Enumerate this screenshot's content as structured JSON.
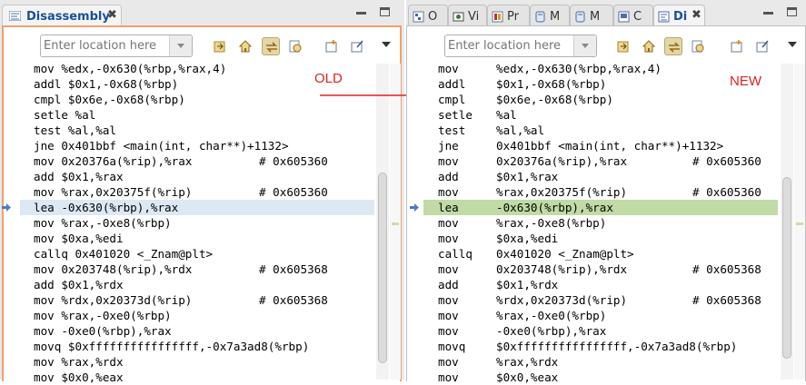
{
  "left_pane": {
    "tab_title": "Disassembly",
    "location_placeholder": "Enter location here",
    "annotation": "OLD",
    "lines": [
      {
        "mnem": "mov %edx,-0x630(%rbp,%rax,4)",
        "comment": ""
      },
      {
        "mnem": "addl $0x1,-0x68(%rbp)",
        "comment": ""
      },
      {
        "mnem": "cmpl $0x6e,-0x68(%rbp)",
        "comment": ""
      },
      {
        "mnem": "setle %al",
        "comment": ""
      },
      {
        "mnem": "test %al,%al",
        "comment": ""
      },
      {
        "mnem": "jne 0x401bbf <main(int, char**)+1132>",
        "comment": ""
      },
      {
        "mnem": "mov 0x20376a(%rip),%rax",
        "comment": "# 0x605360"
      },
      {
        "mnem": "add $0x1,%rax",
        "comment": ""
      },
      {
        "mnem": "mov %rax,0x20375f(%rip)",
        "comment": "# 0x605360"
      },
      {
        "mnem": "lea -0x630(%rbp),%rax",
        "comment": ""
      },
      {
        "mnem": "mov %rax,-0xe8(%rbp)",
        "comment": ""
      },
      {
        "mnem": "mov $0xa,%edi",
        "comment": ""
      },
      {
        "mnem": "callq 0x401020 <_Znam@plt>",
        "comment": ""
      },
      {
        "mnem": "mov 0x203748(%rip),%rdx",
        "comment": "# 0x605368"
      },
      {
        "mnem": "add $0x1,%rdx",
        "comment": ""
      },
      {
        "mnem": "mov %rdx,0x20373d(%rip)",
        "comment": "# 0x605368"
      },
      {
        "mnem": "mov %rax,-0xe0(%rbp)",
        "comment": ""
      },
      {
        "mnem": "mov -0xe0(%rbp),%rax",
        "comment": ""
      },
      {
        "mnem": "movq $0xffffffffffffffff,-0x7a3ad8(%rbp)",
        "comment": ""
      },
      {
        "mnem": "mov %rax,%rdx",
        "comment": ""
      },
      {
        "mnem": "mov $0x0,%eax",
        "comment": ""
      }
    ]
  },
  "right_pane": {
    "tabs": [
      {
        "label": "O",
        "icon": "outline-icon"
      },
      {
        "label": "Vi",
        "icon": "variables-icon"
      },
      {
        "label": "Pr",
        "icon": "problems-icon"
      },
      {
        "label": "M",
        "icon": "memory-icon"
      },
      {
        "label": "M",
        "icon": "memory-icon"
      },
      {
        "label": "C",
        "icon": "console-icon"
      },
      {
        "label": "Di",
        "icon": "disassembly-icon"
      }
    ],
    "location_placeholder": "Enter location here",
    "annotation": "NEW",
    "lines": [
      {
        "op": "mov",
        "args": "%edx,-0x630(%rbp,%rax,4)",
        "comment": ""
      },
      {
        "op": "addl",
        "args": "$0x1,-0x68(%rbp)",
        "comment": ""
      },
      {
        "op": "cmpl",
        "args": "$0x6e,-0x68(%rbp)",
        "comment": ""
      },
      {
        "op": "setle",
        "args": "%al",
        "comment": ""
      },
      {
        "op": "test",
        "args": "%al,%al",
        "comment": ""
      },
      {
        "op": "jne",
        "args": "0x401bbf <main(int, char**)+1132>",
        "comment": ""
      },
      {
        "op": "mov",
        "args": "0x20376a(%rip),%rax",
        "comment": "# 0x605360"
      },
      {
        "op": "add",
        "args": "$0x1,%rax",
        "comment": ""
      },
      {
        "op": "mov",
        "args": "%rax,0x20375f(%rip)",
        "comment": "# 0x605360"
      },
      {
        "op": "lea",
        "args": "-0x630(%rbp),%rax",
        "comment": ""
      },
      {
        "op": "mov",
        "args": "%rax,-0xe8(%rbp)",
        "comment": ""
      },
      {
        "op": "mov",
        "args": "$0xa,%edi",
        "comment": ""
      },
      {
        "op": "callq",
        "args": "0x401020 <_Znam@plt>",
        "comment": ""
      },
      {
        "op": "mov",
        "args": "0x203748(%rip),%rdx",
        "comment": "# 0x605368"
      },
      {
        "op": "add",
        "args": "$0x1,%rdx",
        "comment": ""
      },
      {
        "op": "mov",
        "args": "%rdx,0x20373d(%rip)",
        "comment": "# 0x605368"
      },
      {
        "op": "mov",
        "args": "%rax,-0xe0(%rbp)",
        "comment": ""
      },
      {
        "op": "mov",
        "args": "-0xe0(%rbp),%rax",
        "comment": ""
      },
      {
        "op": "movq",
        "args": "$0xffffffffffffffff,-0x7a3ad8(%rbp)",
        "comment": ""
      },
      {
        "op": "mov",
        "args": "%rax,%rdx",
        "comment": ""
      },
      {
        "op": "mov",
        "args": "$0x0,%eax",
        "comment": ""
      }
    ]
  },
  "current_line_index": 9,
  "colors": {
    "active_frame": "#f0a070",
    "left_highlight": "#dce9f5",
    "right_highlight": "#c0dba5",
    "annotation": "#e02020",
    "tab_title": "#1a4f9a"
  }
}
